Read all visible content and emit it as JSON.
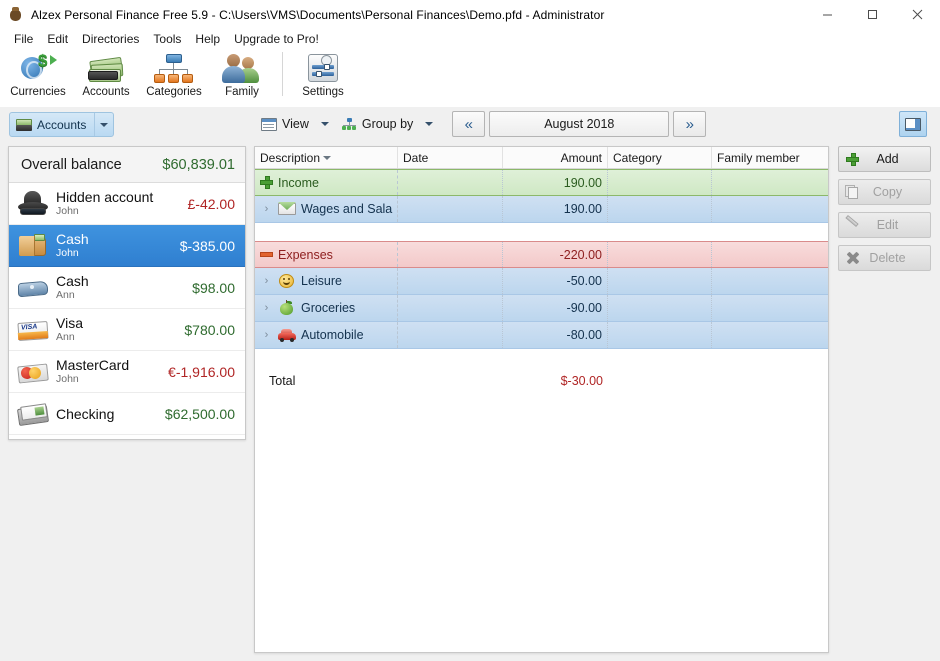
{
  "window": {
    "title": "Alzex Personal Finance Free 5.9 - C:\\Users\\VMS\\Documents\\Personal Finances\\Demo.pfd - Administrator",
    "icon": "money-sack-icon",
    "controls": {
      "minimize": "minimize-icon",
      "maximize": "maximize-icon",
      "close": "close-icon"
    }
  },
  "menu": {
    "items": [
      {
        "label": "File"
      },
      {
        "label": "Edit"
      },
      {
        "label": "Directories"
      },
      {
        "label": "Tools"
      },
      {
        "label": "Help"
      },
      {
        "label": "Upgrade to Pro!"
      }
    ]
  },
  "ribbon": {
    "buttons": [
      {
        "label": "Currencies",
        "icon": "currencies-icon"
      },
      {
        "label": "Accounts",
        "icon": "accounts-icon"
      },
      {
        "label": "Categories",
        "icon": "categories-icon"
      },
      {
        "label": "Family",
        "icon": "family-icon"
      },
      {
        "label": "Settings",
        "icon": "settings-icon"
      }
    ]
  },
  "accounts_button": {
    "label": "Accounts",
    "icon": "accounts-small-icon",
    "caret": "chevron-down-icon"
  },
  "sidebar": {
    "overall": {
      "label": "Overall balance",
      "value": "$60,839.01"
    },
    "accounts": [
      {
        "name": "Hidden account",
        "owner": "John",
        "balance": "£-42.00",
        "sign": "neg",
        "icon": "hat-glasses-icon",
        "selected": false
      },
      {
        "name": "Cash",
        "owner": "John",
        "balance": "$-385.00",
        "sign": "neg",
        "icon": "wallet-icon",
        "selected": true
      },
      {
        "name": "Cash",
        "owner": "Ann",
        "balance": "$98.00",
        "sign": "pos",
        "icon": "purse-icon",
        "selected": false
      },
      {
        "name": "Visa",
        "owner": "Ann",
        "balance": "$780.00",
        "sign": "pos",
        "icon": "visa-card-icon",
        "selected": false
      },
      {
        "name": "MasterCard",
        "owner": "John",
        "balance": "€-1,916.00",
        "sign": "neg",
        "icon": "mastercard-icon",
        "selected": false
      },
      {
        "name": "Checking",
        "owner": "",
        "balance": "$62,500.00",
        "sign": "pos",
        "icon": "checkbook-icon",
        "selected": false
      }
    ]
  },
  "toolbar": {
    "view": {
      "label": "View",
      "icon": "view-icon",
      "caret": "chevron-down-icon"
    },
    "group_by": {
      "label": "Group by",
      "icon": "group-by-icon",
      "caret": "chevron-down-icon"
    },
    "prev_label": "«",
    "next_label": "»",
    "period": "August 2018",
    "layout_toggle": {
      "icon": "panel-layout-icon"
    }
  },
  "grid": {
    "columns": [
      {
        "label": "Description",
        "sorted": true
      },
      {
        "label": "Date"
      },
      {
        "label": "Amount"
      },
      {
        "label": "Category"
      },
      {
        "label": "Family member"
      }
    ],
    "rows": [
      {
        "kind": "group-income",
        "marker": "plus-icon",
        "description": "Income",
        "date": "",
        "amount": "190.00",
        "category": "",
        "family": ""
      },
      {
        "kind": "child",
        "expander": "›",
        "icon": "envelope-money-icon",
        "description": "Wages and Sala",
        "date": "",
        "amount": "190.00",
        "category": "",
        "family": ""
      },
      {
        "kind": "group-expenses",
        "marker": "minus-icon",
        "description": "Expenses",
        "date": "",
        "amount": "-220.00",
        "category": "",
        "family": ""
      },
      {
        "kind": "child",
        "expander": "›",
        "icon": "smiley-icon",
        "description": "Leisure",
        "date": "",
        "amount": "-50.00",
        "category": "",
        "family": ""
      },
      {
        "kind": "child",
        "expander": "›",
        "icon": "apple-icon",
        "description": "Groceries",
        "date": "",
        "amount": "-90.00",
        "category": "",
        "family": ""
      },
      {
        "kind": "child",
        "expander": "›",
        "icon": "car-icon",
        "description": "Automobile",
        "date": "",
        "amount": "-80.00",
        "category": "",
        "family": ""
      }
    ],
    "total": {
      "label": "Total",
      "value": "$-30.00"
    }
  },
  "actions": [
    {
      "label": "Add",
      "icon": "plus-icon",
      "enabled": true
    },
    {
      "label": "Copy",
      "icon": "copy-icon",
      "enabled": false
    },
    {
      "label": "Edit",
      "icon": "pencil-icon",
      "enabled": false
    },
    {
      "label": "Delete",
      "icon": "delete-x-icon",
      "enabled": false
    }
  ],
  "colors": {
    "income_bg": "#dff0d8",
    "expense_bg": "#f8dcdc",
    "child_bg": "#cfe0f2",
    "selection_blue": "#3f93df",
    "positive": "#2f6b2f",
    "negative": "#b02525"
  }
}
